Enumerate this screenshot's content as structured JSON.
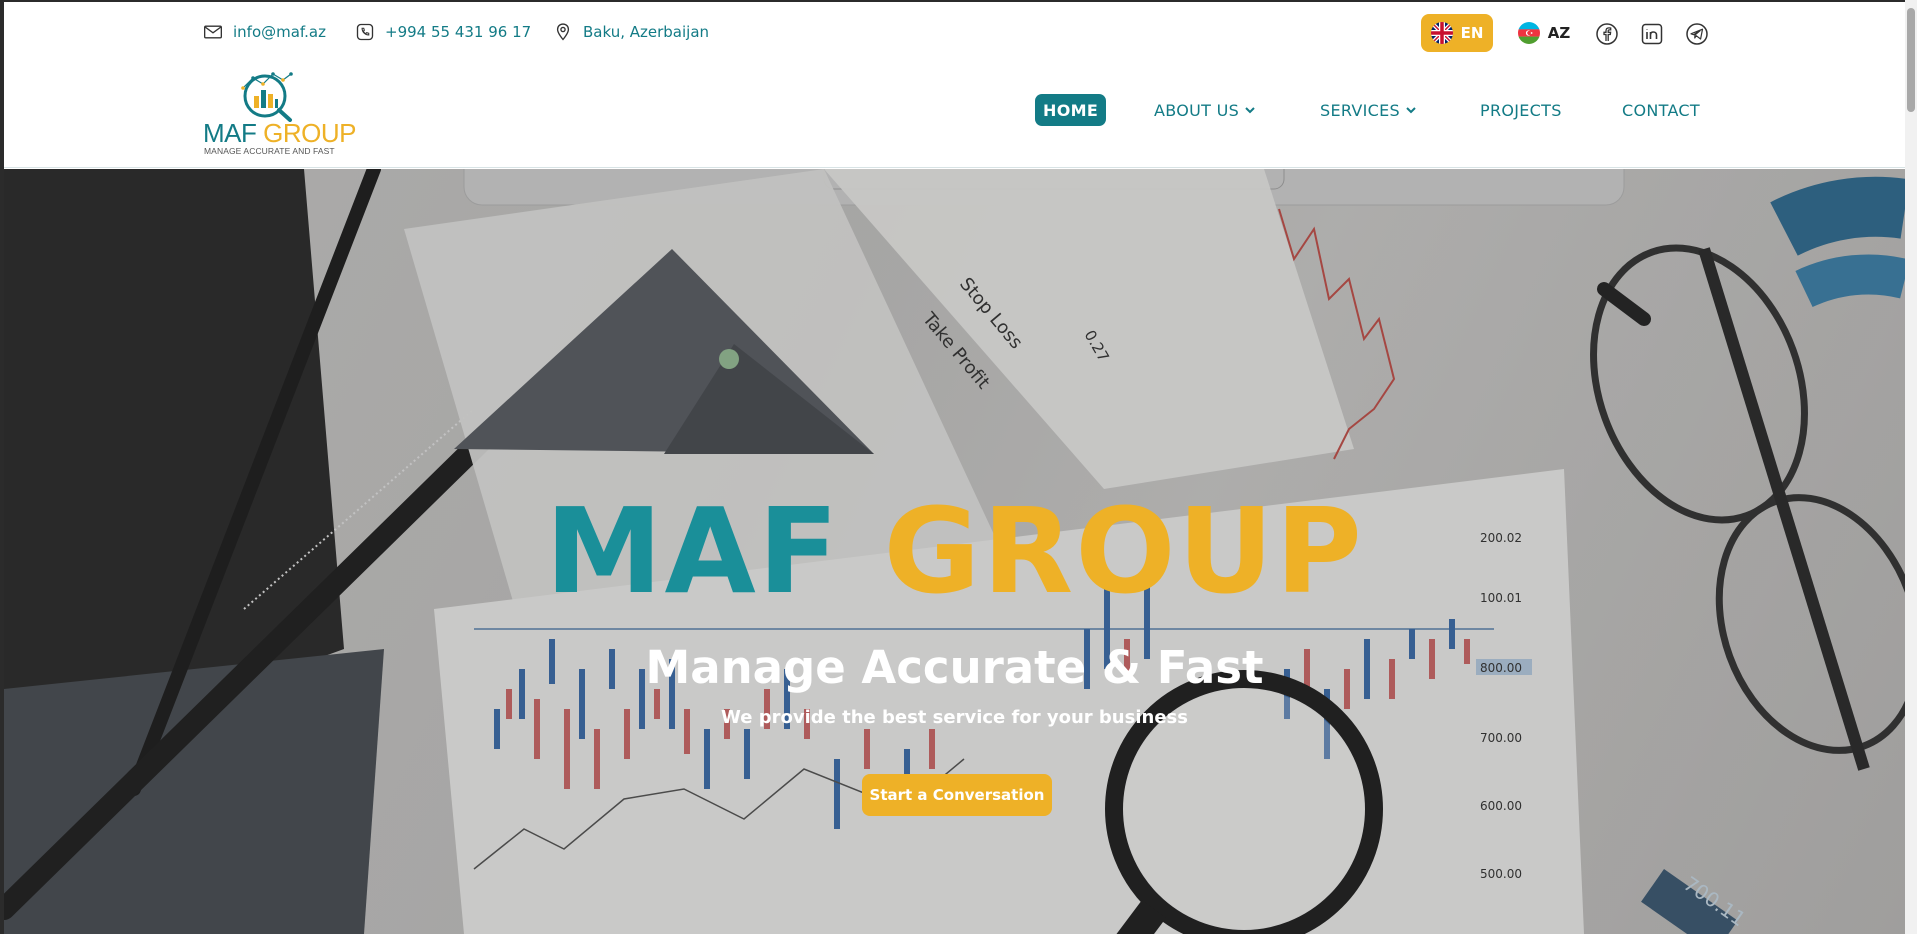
{
  "topbar": {
    "email": "info@maf.az",
    "phone": "+994 55 431 96 17",
    "location": "Baku, Azerbaijan",
    "languages": [
      {
        "code": "EN",
        "active": true
      },
      {
        "code": "AZ",
        "active": false
      }
    ],
    "social": [
      "facebook-icon",
      "linkedin-icon",
      "telegram-icon"
    ]
  },
  "logo": {
    "word_left": "MAF",
    "word_right": "GROUP",
    "tagline": "MANAGE ACCURATE AND FAST"
  },
  "nav": {
    "items": [
      {
        "label": "HOME",
        "active": true,
        "dropdown": false
      },
      {
        "label": "ABOUT US",
        "active": false,
        "dropdown": true
      },
      {
        "label": "SERVICES",
        "active": false,
        "dropdown": true
      },
      {
        "label": "PROJECTS",
        "active": false,
        "dropdown": false
      },
      {
        "label": "CONTACT",
        "active": false,
        "dropdown": false
      }
    ]
  },
  "hero": {
    "title_left": "MAF",
    "title_right": "GROUP",
    "subtitle": "Manage Accurate & Fast",
    "description": "We provide the best service for your business",
    "cta_label": "Start a Conversation",
    "bg_labels": {
      "stop_loss": "Stop Loss",
      "take_profit": "Take Profit",
      "value_027": "0.27",
      "ticks": [
        "200.02",
        "100.01",
        "800.00",
        "700.00",
        "600.00",
        "500.00"
      ],
      "tag": "700.11"
    }
  },
  "colors": {
    "teal": "#137b86",
    "gold": "#eeb127"
  }
}
